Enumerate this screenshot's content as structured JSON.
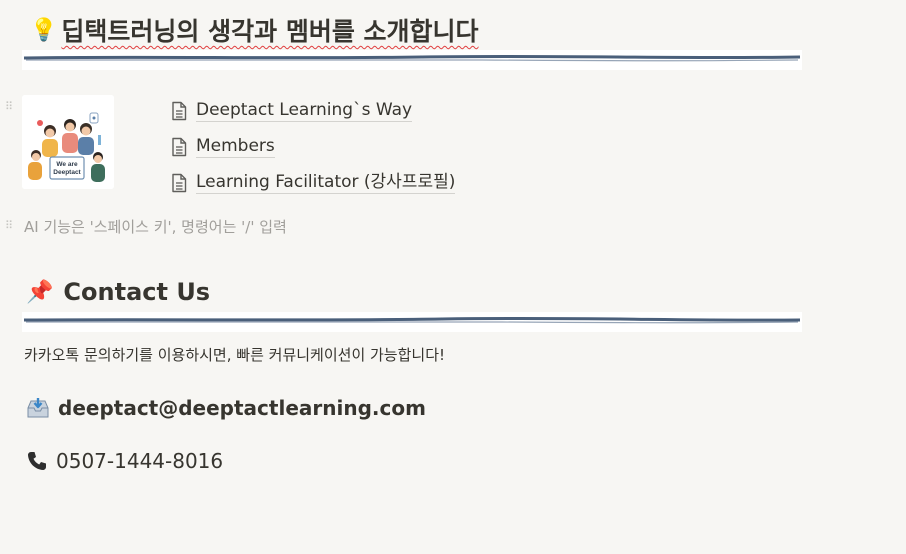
{
  "header": {
    "emoji": "💡",
    "title": "딥택트러닝의 생각과 멤버를 소개합니다"
  },
  "thumbnail": {
    "text_line1": "We are",
    "text_line2": "Deeptact"
  },
  "pages": [
    {
      "label": "Deeptact Learning`s Way"
    },
    {
      "label": "Members"
    },
    {
      "label": "Learning Facilitator (강사프로필)"
    }
  ],
  "placeholder": "AI 기능은 '스페이스 키', 명령어는 '/' 입력",
  "contact": {
    "emoji": "📌",
    "title": "Contact Us",
    "description": "카카오톡 문의하기를 이용하시면, 빠른 커뮤니케이션이 가능합니다!",
    "email": "deeptact@deeptactlearning.com",
    "phone": "0507-1444-8016"
  },
  "colors": {
    "background": "#f7f6f3",
    "divider": "#4a5f7a",
    "text": "#37352f",
    "placeholder": "#a19f9b"
  },
  "icons": [
    "lightbulb-icon",
    "page-icon",
    "pushpin-icon",
    "inbox-tray-icon",
    "telephone-icon",
    "drag-handle-icon"
  ]
}
